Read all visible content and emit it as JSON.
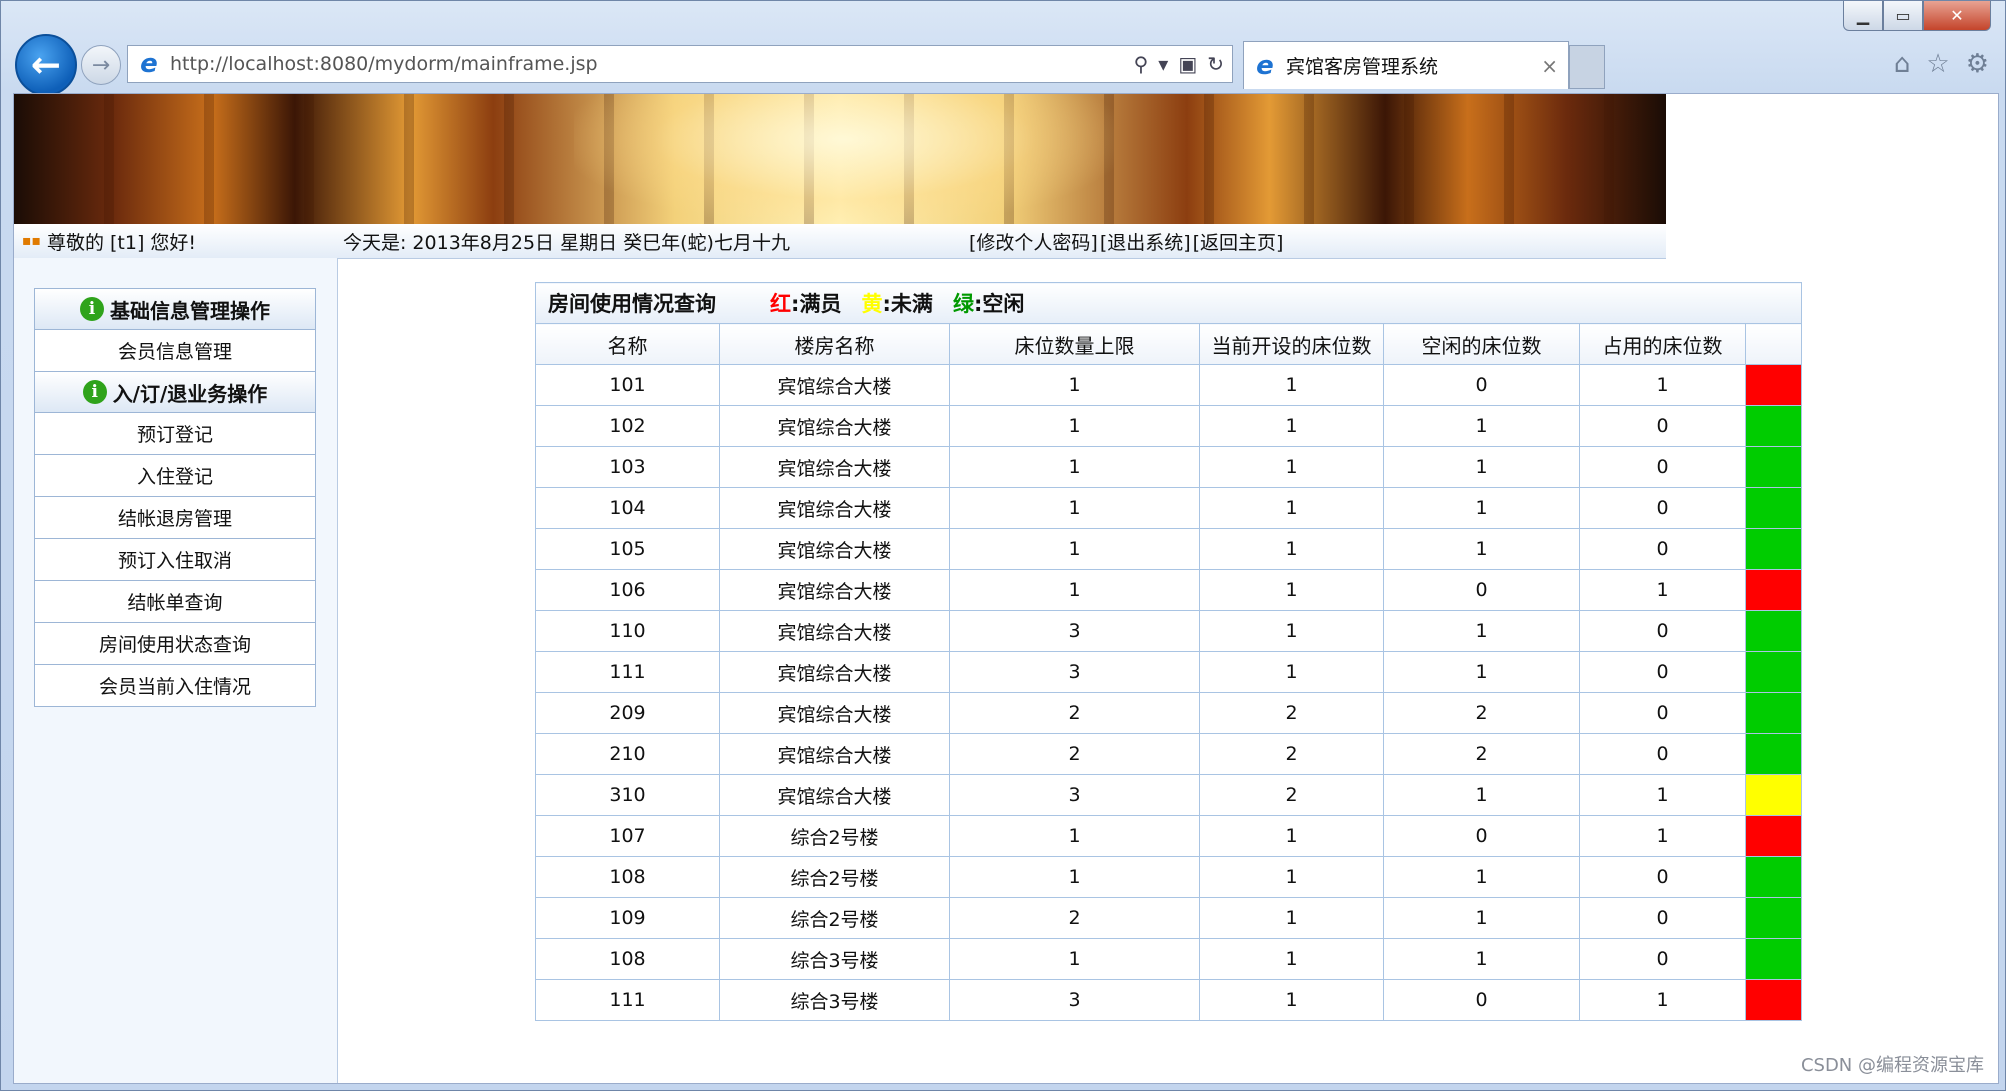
{
  "browser": {
    "url": "http://localhost:8080/mydorm/mainframe.jsp",
    "tab_title": "宾馆客房管理系统",
    "tab_close": "×",
    "win_min": "▁",
    "win_max": "▭",
    "win_close": "✕",
    "back_arrow": "←",
    "forward_arrow": "→",
    "icons": [
      "search-icon",
      "dropdown-icon",
      "compat-icon",
      "refresh-icon",
      "home-icon",
      "favorites-star-icon",
      "settings-gear-icon"
    ]
  },
  "infobar": {
    "greeting": "尊敬的 [t1] 您好!",
    "date": "今天是:  2013年8月25日  星期日  癸巳年(蛇)七月十九",
    "links": [
      "[修改个人密码]",
      "[退出系统]",
      "[返回主页]"
    ]
  },
  "sidebar": {
    "section1_title": "基础信息管理操作",
    "section1_items": [
      "会员信息管理"
    ],
    "section2_title": "入/订/退业务操作",
    "section2_items": [
      "预订登记",
      "入住登记",
      "结帐退房管理",
      "预订入住取消",
      "结帐单查询",
      "房间使用状态查询",
      "会员当前入住情况"
    ]
  },
  "table": {
    "title": "房间使用情况查询",
    "legend": [
      {
        "key": "红",
        "label": "满员",
        "color": "#ff0000"
      },
      {
        "key": "黄",
        "label": "未满",
        "color": "#ffff00"
      },
      {
        "key": "绿",
        "label": "空闲",
        "color": "#009900"
      }
    ],
    "colon": ":",
    "headers": [
      "名称",
      "楼房名称",
      "床位数量上限",
      "当前开设的床位数",
      "空闲的床位数",
      "占用的床位数",
      ""
    ],
    "rows": [
      {
        "name": "101",
        "building": "宾馆综合大楼",
        "max": "1",
        "open": "1",
        "free": "0",
        "used": "1",
        "status_color": "#ff0000"
      },
      {
        "name": "102",
        "building": "宾馆综合大楼",
        "max": "1",
        "open": "1",
        "free": "1",
        "used": "0",
        "status_color": "#00cc00"
      },
      {
        "name": "103",
        "building": "宾馆综合大楼",
        "max": "1",
        "open": "1",
        "free": "1",
        "used": "0",
        "status_color": "#00cc00"
      },
      {
        "name": "104",
        "building": "宾馆综合大楼",
        "max": "1",
        "open": "1",
        "free": "1",
        "used": "0",
        "status_color": "#00cc00"
      },
      {
        "name": "105",
        "building": "宾馆综合大楼",
        "max": "1",
        "open": "1",
        "free": "1",
        "used": "0",
        "status_color": "#00cc00"
      },
      {
        "name": "106",
        "building": "宾馆综合大楼",
        "max": "1",
        "open": "1",
        "free": "0",
        "used": "1",
        "status_color": "#ff0000"
      },
      {
        "name": "110",
        "building": "宾馆综合大楼",
        "max": "3",
        "open": "1",
        "free": "1",
        "used": "0",
        "status_color": "#00cc00"
      },
      {
        "name": "111",
        "building": "宾馆综合大楼",
        "max": "3",
        "open": "1",
        "free": "1",
        "used": "0",
        "status_color": "#00cc00"
      },
      {
        "name": "209",
        "building": "宾馆综合大楼",
        "max": "2",
        "open": "2",
        "free": "2",
        "used": "0",
        "status_color": "#00cc00"
      },
      {
        "name": "210",
        "building": "宾馆综合大楼",
        "max": "2",
        "open": "2",
        "free": "2",
        "used": "0",
        "status_color": "#00cc00"
      },
      {
        "name": "310",
        "building": "宾馆综合大楼",
        "max": "3",
        "open": "2",
        "free": "1",
        "used": "1",
        "status_color": "#ffff00"
      },
      {
        "name": "107",
        "building": "综合2号楼",
        "max": "1",
        "open": "1",
        "free": "0",
        "used": "1",
        "status_color": "#ff0000"
      },
      {
        "name": "108",
        "building": "综合2号楼",
        "max": "1",
        "open": "1",
        "free": "1",
        "used": "0",
        "status_color": "#00cc00"
      },
      {
        "name": "109",
        "building": "综合2号楼",
        "max": "2",
        "open": "1",
        "free": "1",
        "used": "0",
        "status_color": "#00cc00"
      },
      {
        "name": "108",
        "building": "综合3号楼",
        "max": "1",
        "open": "1",
        "free": "1",
        "used": "0",
        "status_color": "#00cc00"
      },
      {
        "name": "111",
        "building": "综合3号楼",
        "max": "3",
        "open": "1",
        "free": "0",
        "used": "1",
        "status_color": "#ff0000"
      }
    ]
  },
  "watermark": "CSDN @编程资源宝库"
}
